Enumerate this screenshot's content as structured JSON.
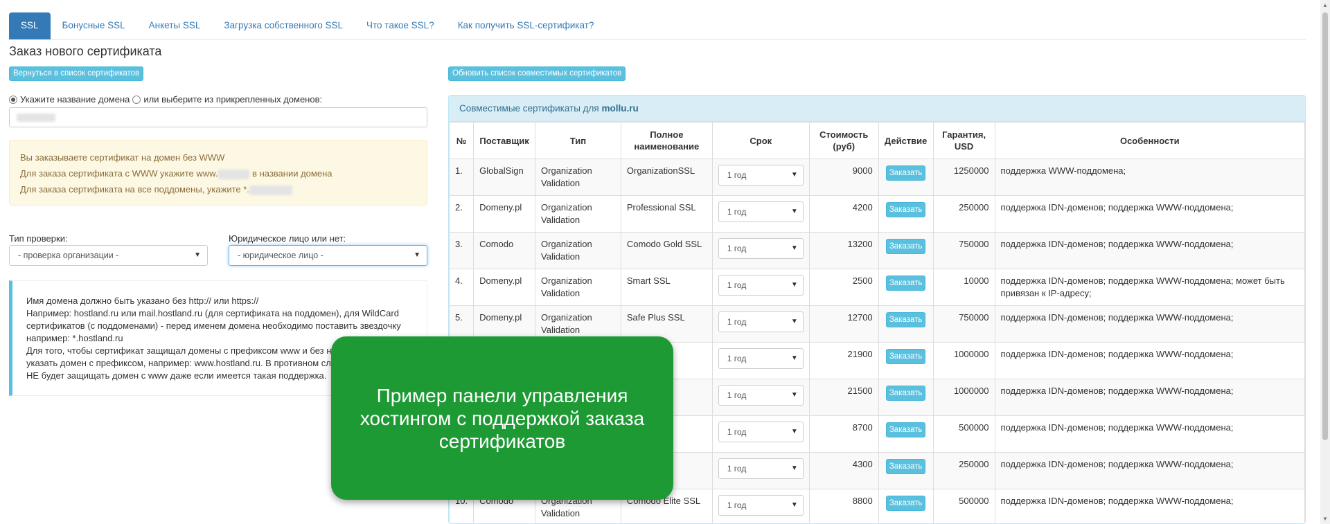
{
  "tabs": [
    {
      "label": "SSL",
      "active": true
    },
    {
      "label": "Бонусные SSL"
    },
    {
      "label": "Анкеты SSL"
    },
    {
      "label": "Загрузка собственного SSL"
    },
    {
      "label": "Что такое SSL?"
    },
    {
      "label": "Как получить SSL-сертификат?"
    }
  ],
  "page_title": "Заказ нового сертификата",
  "back_button": "Вернуться в список сертификатов",
  "refresh_button": "Обновить список совместимых сертификатов",
  "domain_choice": {
    "option1": "Укажите название домена",
    "option2": "или выберите из прикрепленных доменов:"
  },
  "warning": {
    "line1": "Вы заказываете сертификат на домен без WWW",
    "line2a": "Для заказа сертификата с WWW укажите www.",
    "line2b": "в названии домена",
    "line3": "Для заказа сертификата на все поддомены, укажите *."
  },
  "check_type": {
    "label": "Тип проверки:",
    "value": "- проверка организации -"
  },
  "legal_entity": {
    "label": "Юридическое лицо или нет:",
    "value": "- юридическое лицо -"
  },
  "note": {
    "l1": "Имя домена должно быть указано без http:// или https://",
    "l2": "Например: hostland.ru или mail.hostland.ru (для сертификата на поддомен), для WildCard",
    "l3": "сертификатов (с поддоменами) - перед именем домена необходимо поставить звездочку",
    "l4": "например: *.hostland.ru",
    "l5": "Для того, чтобы сертификат защищал домены с префиксом www и без н",
    "l6": "указать домен с префиксом, например: www.hostland.ru. В противном сл",
    "l7": "НЕ будет защищать домен с www даже если имеется такая поддержка."
  },
  "panel": {
    "title_prefix": "Совместимые сертификаты для",
    "domain": "mollu.ru"
  },
  "table": {
    "headers": {
      "num": "№",
      "vendor": "Поставщик",
      "type": "Тип",
      "name_l1": "Полное",
      "name_l2": "наименование",
      "term": "Срок",
      "price_l1": "Стоимость",
      "price_l2": "(руб)",
      "action": "Действие",
      "warranty_l1": "Гарантия,",
      "warranty_l2": "USD",
      "features": "Особенности"
    },
    "order_label": "Заказать",
    "term_value": "1 год",
    "rows": [
      {
        "n": "1.",
        "vendor": "GlobalSign",
        "type_l1": "Organization",
        "type_l2": "Validation",
        "name": "OrganizationSSL",
        "price": "9000",
        "warranty": "1250000",
        "features": "поддержка WWW-поддомена;"
      },
      {
        "n": "2.",
        "vendor": "Domeny.pl",
        "type_l1": "Organization",
        "type_l2": "Validation",
        "name": "Professional SSL",
        "price": "4200",
        "warranty": "250000",
        "features": "поддержка IDN-доменов; поддержка WWW-поддомена;"
      },
      {
        "n": "3.",
        "vendor": "Comodo",
        "type_l1": "Organization",
        "type_l2": "Validation",
        "name": "Comodo Gold SSL",
        "price": "13200",
        "warranty": "750000",
        "features": "поддержка IDN-доменов; поддержка WWW-поддомена;"
      },
      {
        "n": "4.",
        "vendor": "Domeny.pl",
        "type_l1": "Organization",
        "type_l2": "Validation",
        "name": "Smart SSL",
        "price": "2500",
        "warranty": "10000",
        "features": "поддержка IDN-доменов; поддержка WWW-поддомена; может быть привязан к IP-адресу;"
      },
      {
        "n": "5.",
        "vendor": "Domeny.pl",
        "type_l1": "Organization",
        "type_l2": "Validation",
        "name": "Safe Plus SSL",
        "price": "12700",
        "warranty": "750000",
        "features": "поддержка IDN-доменов; поддержка WWW-поддомена;"
      },
      {
        "n": "",
        "vendor": "",
        "type_l1": "",
        "type_l2": "",
        "name": "atinum",
        "price": "21900",
        "warranty": "1000000",
        "features": "поддержка IDN-доменов; поддержка WWW-поддомена;"
      },
      {
        "n": "",
        "vendor": "",
        "type_l1": "",
        "type_l2": "",
        "name": "SSL",
        "price": "21500",
        "warranty": "1000000",
        "features": "поддержка IDN-доменов; поддержка WWW-поддомена;"
      },
      {
        "n": "",
        "vendor": "",
        "type_l1": "",
        "type_l2": "",
        "name": "",
        "price": "8700",
        "warranty": "500000",
        "features": "поддержка IDN-доменов; поддержка WWW-поддомена;"
      },
      {
        "n": "",
        "vendor": "",
        "type_l1": "",
        "type_l2": "",
        "name": "L",
        "price": "4300",
        "warranty": "250000",
        "features": "поддержка IDN-доменов; поддержка WWW-поддомена;"
      },
      {
        "n": "10.",
        "vendor": "Comodo",
        "type_l1": "Organization",
        "type_l2": "Validation",
        "name": "Comodo Elite SSL",
        "price": "8800",
        "warranty": "500000",
        "features": "поддержка IDN-доменов; поддержка WWW-поддомена;"
      }
    ]
  },
  "overlay_text": "Пример панели управления хостингом с поддержкой заказа сертификатов",
  "colors": {
    "primary": "#337ab7",
    "info": "#5bc0de",
    "overlay": "#1e9a34",
    "warning_bg": "#fcf8e3"
  }
}
